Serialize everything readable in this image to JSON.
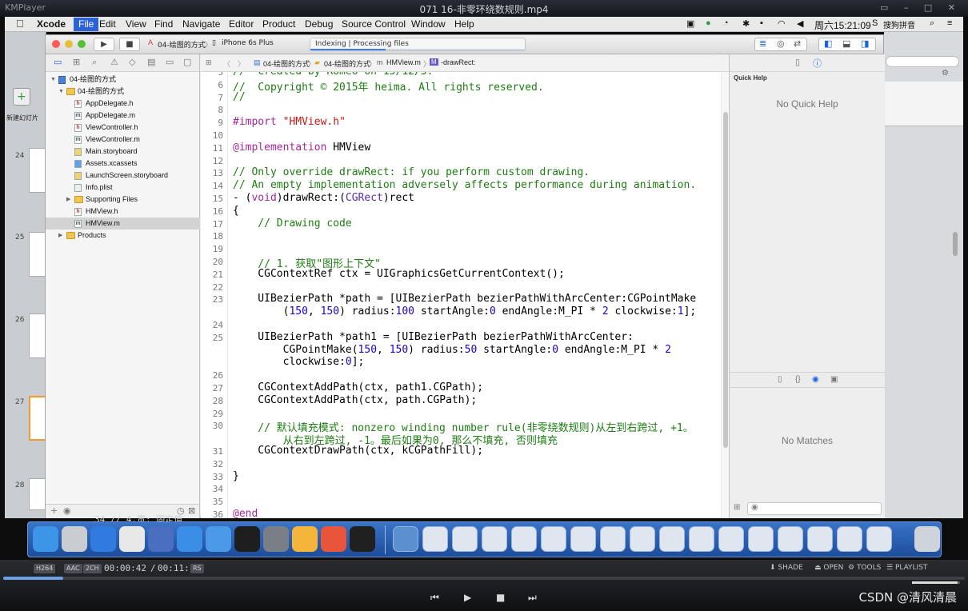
{
  "player": {
    "app_name": "KMPlayer",
    "file_title": "071 16-非零环绕数规则.mp4",
    "codec_badges": [
      "H264",
      "AAC",
      "2CH"
    ],
    "time_current": "00:00:42",
    "time_total": "00:11:15",
    "time_sep": "/",
    "rs_badge": "RS",
    "right_buttons": [
      "SHADE",
      "OPEN",
      "TOOLS",
      "PLAYLIST"
    ],
    "progress": 0.062,
    "volume": 0.95,
    "watermark": "CSDN @清风清晨"
  },
  "menubar": {
    "items": [
      "Xcode",
      "File",
      "Edit",
      "View",
      "Find",
      "Navigate",
      "Editor",
      "Product",
      "Debug",
      "Source Control",
      "Window",
      "Help"
    ],
    "active": "File",
    "clock": "周六15:21:09",
    "input_method": "搜狗拼音"
  },
  "toolbar": {
    "scheme_project": "04-绘图的方式",
    "scheme_device": "iPhone 6s Plus",
    "activity_status": "Indexing | Processing files",
    "activity_progress": 0.35
  },
  "navigator": {
    "items": [
      {
        "label": "04-绘图的方式",
        "kind": "project",
        "indent": 0,
        "open": true
      },
      {
        "label": "04-绘图的方式",
        "kind": "folder",
        "indent": 1,
        "open": true
      },
      {
        "label": "AppDelegate.h",
        "kind": "h",
        "indent": 2
      },
      {
        "label": "AppDelegate.m",
        "kind": "m",
        "indent": 2
      },
      {
        "label": "ViewController.h",
        "kind": "h",
        "indent": 2
      },
      {
        "label": "ViewController.m",
        "kind": "m",
        "indent": 2
      },
      {
        "label": "Main.storyboard",
        "kind": "sb",
        "indent": 2
      },
      {
        "label": "Assets.xcassets",
        "kind": "assets",
        "indent": 2
      },
      {
        "label": "LaunchScreen.storyboard",
        "kind": "sb",
        "indent": 2
      },
      {
        "label": "Info.plist",
        "kind": "plist",
        "indent": 2
      },
      {
        "label": "Supporting Files",
        "kind": "folder",
        "indent": 2,
        "open": false
      },
      {
        "label": "HMView.h",
        "kind": "h",
        "indent": 2
      },
      {
        "label": "HMView.m",
        "kind": "m",
        "indent": 2,
        "selected": true
      },
      {
        "label": "Products",
        "kind": "folder",
        "indent": 1,
        "open": false
      }
    ]
  },
  "jumpbar": {
    "crumbs": [
      "04-绘图的方式",
      "04-绘图的方式",
      "HMView.m",
      "-drawRect:"
    ]
  },
  "editor": {
    "lines": [
      {
        "n": "5",
        "text": "//  Created by Romeo on 15/12/3.",
        "cls": "cmt"
      },
      {
        "n": "6",
        "text": "//  Copyright © 2015年 heima. All rights reserved.",
        "cls": "cmt"
      },
      {
        "n": "7",
        "text": "//",
        "cls": "cmt"
      },
      {
        "n": "8",
        "text": "",
        "cls": ""
      },
      {
        "n": "9",
        "text": "#import \"HMView.h\"",
        "cls": "str"
      },
      {
        "n": "10",
        "text": "",
        "cls": ""
      },
      {
        "n": "11",
        "text": "@implementation HMView",
        "cls": "impl"
      },
      {
        "n": "12",
        "text": "",
        "cls": ""
      },
      {
        "n": "13",
        "text": "// Only override drawRect: if you perform custom drawing.",
        "cls": "cmt"
      },
      {
        "n": "14",
        "text": "// An empty implementation adversely affects performance during animation.",
        "cls": "cmt"
      },
      {
        "n": "15",
        "text": "- (void)drawRect:(CGRect)rect",
        "cls": "sig"
      },
      {
        "n": "16",
        "text": "{",
        "cls": ""
      },
      {
        "n": "17",
        "text": "    // Drawing code",
        "cls": "cmt"
      },
      {
        "n": "18",
        "text": "",
        "cls": ""
      },
      {
        "n": "19",
        "text": "",
        "cls": ""
      },
      {
        "n": "20",
        "text": "    // 1. 获取\"图形上下文\"",
        "cls": "cmt"
      },
      {
        "n": "21",
        "text": "    CGContextRef ctx = UIGraphicsGetCurrentContext();",
        "cls": ""
      },
      {
        "n": "22",
        "text": "",
        "cls": ""
      },
      {
        "n": "23",
        "text": "    UIBezierPath *path = [UIBezierPath bezierPathWithArcCenter:CGPointMake",
        "cls": ""
      },
      {
        "n": "",
        "text": "        (150, 150) radius:100 startAngle:0 endAngle:M_PI * 2 clockwise:1];",
        "cls": ""
      },
      {
        "n": "24",
        "text": "",
        "cls": ""
      },
      {
        "n": "25",
        "text": "    UIBezierPath *path1 = [UIBezierPath bezierPathWithArcCenter:",
        "cls": ""
      },
      {
        "n": "",
        "text": "        CGPointMake(150, 150) radius:50 startAngle:0 endAngle:M_PI * 2",
        "cls": ""
      },
      {
        "n": "",
        "text": "        clockwise:0];",
        "cls": ""
      },
      {
        "n": "26",
        "text": "",
        "cls": ""
      },
      {
        "n": "27",
        "text": "    CGContextAddPath(ctx, path1.CGPath);",
        "cls": ""
      },
      {
        "n": "28",
        "text": "    CGContextAddPath(ctx, path.CGPath);",
        "cls": ""
      },
      {
        "n": "29",
        "text": "",
        "cls": ""
      },
      {
        "n": "30",
        "text": "    // 默认填充模式: nonzero winding number rule(非零绕数规则)从左到右跨过, +1。",
        "cls": "cmt"
      },
      {
        "n": "",
        "text": "        从右到左跨过, -1。最后如果为0, 那么不填充, 否则填充",
        "cls": "cmt"
      },
      {
        "n": "31",
        "text": "    CGContextDrawPath(ctx, kCGPathFill);",
        "cls": ""
      },
      {
        "n": "32",
        "text": "",
        "cls": ""
      },
      {
        "n": "33",
        "text": "}",
        "cls": ""
      },
      {
        "n": "34",
        "text": "",
        "cls": ""
      },
      {
        "n": "35",
        "text": "",
        "cls": ""
      },
      {
        "n": "36",
        "text": "@end",
        "cls": "kw"
      }
    ]
  },
  "inspector": {
    "quick_help_label": "Quick Help",
    "quick_help_empty": "No Quick Help",
    "library_empty": "No Matches"
  },
  "behind_window": {
    "line_text": "34  // 4.宽: 固定值"
  },
  "keynote_side": {
    "new_slide_label": "新建幻灯片",
    "slide_numbers": [
      "24",
      "25",
      "26",
      "27",
      "28"
    ]
  }
}
